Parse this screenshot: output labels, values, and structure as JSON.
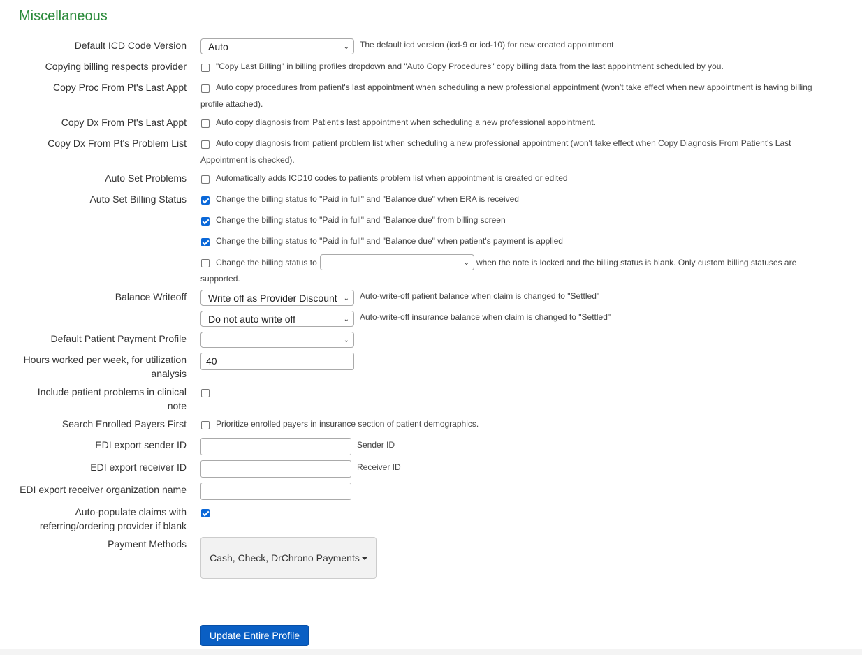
{
  "title": "Miscellaneous",
  "icd": {
    "label": "Default ICD Code Version",
    "value": "Auto",
    "help": "The default icd version (icd-9 or icd-10) for new created appointment"
  },
  "copy_billing": {
    "label": "Copying billing respects provider",
    "checked": false,
    "help": "\"Copy Last Billing\" in billing profiles dropdown and \"Auto Copy Procedures\" copy billing data from the last appointment scheduled by you."
  },
  "copy_proc": {
    "label": "Copy Proc From Pt's Last Appt",
    "checked": false,
    "help1": "Auto copy procedures from patient's last appointment when scheduling a new professional appointment (won't take effect when new appointment is having billing",
    "help2": "profile attached)."
  },
  "copy_dx_last": {
    "label": "Copy Dx From Pt's Last Appt",
    "checked": false,
    "help": "Auto copy diagnosis from Patient's last appointment when scheduling a new professional appointment."
  },
  "copy_dx_problem": {
    "label": "Copy Dx From Pt's Problem List",
    "checked": false,
    "help1": "Auto copy diagnosis from patient problem list when scheduling a new professional appointment (won't take effect when Copy Diagnosis From Patient's Last",
    "help2": "Appointment is checked)."
  },
  "auto_problems": {
    "label": "Auto Set Problems",
    "checked": false,
    "help": "Automatically adds ICD10 codes to patients problem list when appointment is created or edited"
  },
  "billing_status": {
    "label": "Auto Set Billing Status",
    "opt1": {
      "checked": true,
      "help": "Change the billing status to \"Paid in full\" and \"Balance due\" when ERA is received"
    },
    "opt2": {
      "checked": true,
      "help": "Change the billing status to \"Paid in full\" and \"Balance due\" from billing screen"
    },
    "opt3": {
      "checked": true,
      "help": "Change the billing status to \"Paid in full\" and \"Balance due\" when patient's payment is applied"
    },
    "opt4": {
      "checked": false,
      "help_pre": "Change the billing status to",
      "select_value": "",
      "help_post": "when the note is locked and the billing status is blank. Only custom billing statuses are",
      "help2": "supported."
    }
  },
  "writeoff": {
    "label": "Balance Writeoff",
    "patient_value": "Write off as Provider Discount",
    "patient_help": "Auto-write-off patient balance when claim is changed to \"Settled\"",
    "insurance_value": "Do not auto write off",
    "insurance_help": "Auto-write-off insurance balance when claim is changed to \"Settled\""
  },
  "payment_profile": {
    "label": "Default Patient Payment Profile",
    "value": ""
  },
  "hours": {
    "label1": "Hours worked per week, for utilization",
    "label2": "analysis",
    "value": "40"
  },
  "include_problems": {
    "label1": "Include patient problems in clinical",
    "label2": "note",
    "checked": false
  },
  "enrolled": {
    "label": "Search Enrolled Payers First",
    "checked": false,
    "help": "Prioritize enrolled payers in insurance section of patient demographics."
  },
  "edi_sender": {
    "label": "EDI export sender ID",
    "value": "",
    "help": "Sender ID"
  },
  "edi_receiver": {
    "label": "EDI export receiver ID",
    "value": "",
    "help": "Receiver ID"
  },
  "edi_org": {
    "label": "EDI export receiver organization name",
    "value": ""
  },
  "auto_populate": {
    "label1": "Auto-populate claims with",
    "label2": "referring/ordering provider if blank",
    "checked": true
  },
  "payment_methods": {
    "label": "Payment Methods",
    "value": "Cash, Check, DrChrono Payments"
  },
  "submit": "Update Entire Profile",
  "colors": {
    "title": "#2a8a3a",
    "primary": "#0a5fc4",
    "checkbox": "#0b68d8"
  }
}
